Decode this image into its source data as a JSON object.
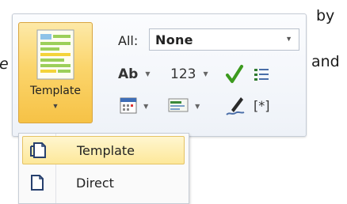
{
  "background_text": {
    "by": "by",
    "and": "and",
    "left_fragment": "e"
  },
  "ribbon": {
    "template_button_label": "Template",
    "all_label": "All:",
    "all_combo_value": "None",
    "ab_label": "Ab",
    "num_label": "123",
    "field_label": "[*]"
  },
  "menu": {
    "items": [
      {
        "label": "Template",
        "icon": "template-doc-icon",
        "selected": true
      },
      {
        "label": "Direct",
        "icon": "direct-doc-icon",
        "selected": false
      }
    ]
  },
  "colors": {
    "template_button_gradient_top": "#fde9a8",
    "template_button_gradient_bottom": "#f6c246",
    "checkmark": "#3c9a1e",
    "menu_highlight": "#fde89a"
  }
}
